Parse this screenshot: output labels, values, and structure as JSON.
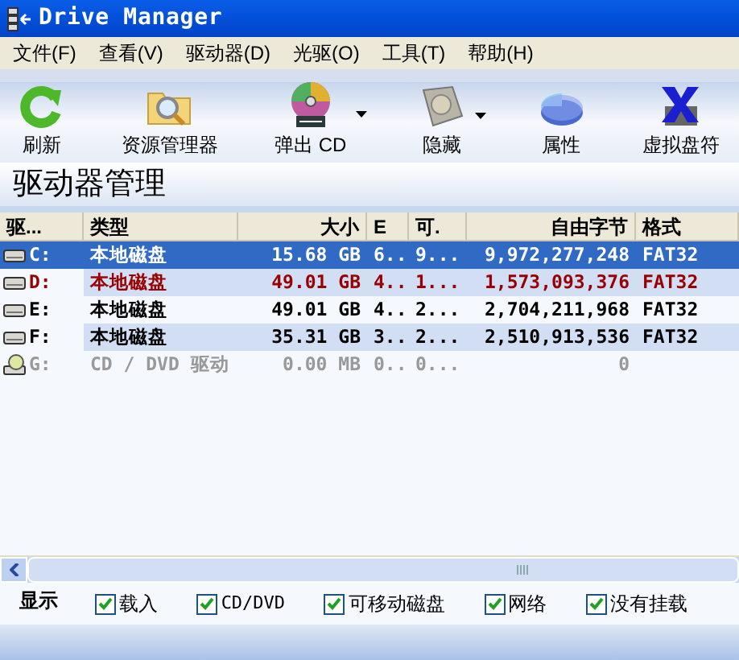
{
  "window": {
    "title": "Drive Manager"
  },
  "menu": [
    "文件(F)",
    "查看(V)",
    "驱动器(D)",
    "光驱(O)",
    "工具(T)",
    "帮助(H)"
  ],
  "toolbar": [
    {
      "label": "刷新",
      "kind": "refresh",
      "dropdown": false
    },
    {
      "label": "资源管理器",
      "kind": "explorer",
      "dropdown": false
    },
    {
      "label": "弹出 CD",
      "kind": "eject",
      "dropdown": true
    },
    {
      "label": "隐藏",
      "kind": "hide",
      "dropdown": true
    },
    {
      "label": "属性",
      "kind": "properties",
      "dropdown": false
    },
    {
      "label": "虚拟盘符",
      "kind": "virtual",
      "dropdown": false
    }
  ],
  "heading": "驱动器管理",
  "table": {
    "columns": [
      "驱...",
      "类型",
      "大小",
      "E",
      "可.",
      "自由字节",
      "格式"
    ],
    "rows": [
      {
        "kind": "disk",
        "selected": true,
        "cells": [
          "C:",
          "本地磁盘",
          "15.68 GB",
          "6..",
          "9...",
          "9,972,277,248",
          "FAT32"
        ]
      },
      {
        "kind": "disk",
        "selected": false,
        "highlighted": true,
        "cells": [
          "D:",
          "本地磁盘",
          "49.01 GB",
          "4..",
          "1...",
          "1,573,093,376",
          "FAT32"
        ]
      },
      {
        "kind": "disk",
        "selected": false,
        "highlighted": false,
        "disabled": false,
        "cells": [
          "E:",
          "本地磁盘",
          "49.01 GB",
          "4..",
          "2...",
          "2,704,211,968",
          "FAT32"
        ]
      },
      {
        "kind": "disk",
        "selected": false,
        "highlighted": false,
        "disabled": false,
        "cells": [
          "F:",
          "本地磁盘",
          "35.31 GB",
          "3..",
          "2...",
          "2,510,913,536",
          "FAT32"
        ]
      },
      {
        "kind": "cdrom",
        "selected": false,
        "highlighted": false,
        "disabled": true,
        "cells": [
          "G:",
          "CD / DVD 驱动",
          "0.00 MB",
          "0..",
          "0...",
          "0",
          ""
        ]
      }
    ]
  },
  "show": {
    "label": "显示",
    "options": [
      {
        "label": "载入",
        "checked": true
      },
      {
        "label": "CD/DVD",
        "checked": true
      },
      {
        "label": "可移动磁盘",
        "checked": true
      },
      {
        "label": "网络",
        "checked": true
      },
      {
        "label": "没有挂载",
        "checked": true
      }
    ]
  }
}
